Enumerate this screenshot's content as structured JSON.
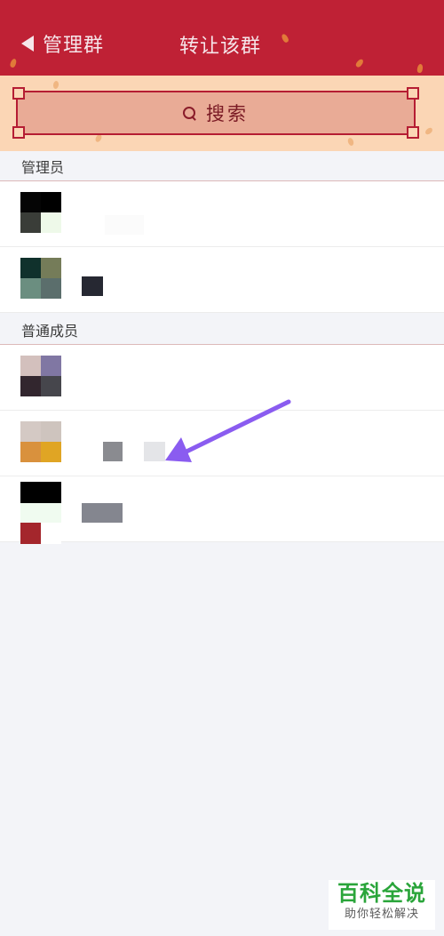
{
  "header": {
    "title": "管理群",
    "transfer_label": "转让该群"
  },
  "search": {
    "label": "搜索"
  },
  "sections": {
    "admins_label": "管理员",
    "members_label": "普通成员"
  },
  "watermark": {
    "title": "百科全说",
    "subtitle": "助你轻松解决"
  },
  "colors": {
    "header_bg": "#bf2135",
    "search_band_bg": "#fbd6b5",
    "search_box_bg": "#e9ab96",
    "frame_red": "#b51d33",
    "arrow": "#8a5cf0",
    "watermark_green": "#2aa53a"
  }
}
